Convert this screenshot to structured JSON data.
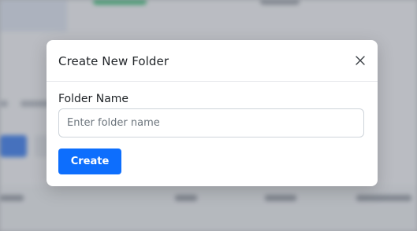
{
  "modal": {
    "title": "Create New Folder",
    "field_label": "Folder Name",
    "input_placeholder": "Enter folder name",
    "input_value": "",
    "create_label": "Create",
    "close_icon": "close-icon"
  },
  "colors": {
    "primary": "#0d6efd",
    "overlay": "#5a5f69"
  }
}
